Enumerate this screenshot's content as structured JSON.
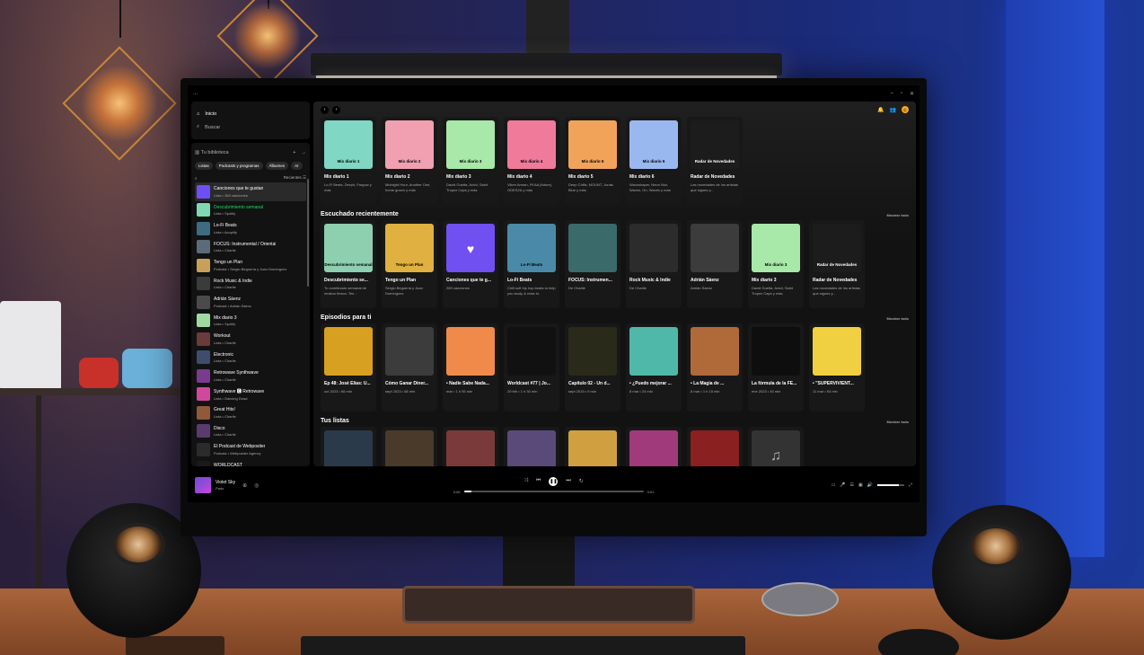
{
  "titlebar": {
    "menu": "...",
    "window_controls": [
      "–",
      "▫",
      "✕"
    ]
  },
  "sidebar": {
    "nav": [
      {
        "label": "Inicio",
        "icon": "home-icon",
        "symbol": "⌂",
        "active": true
      },
      {
        "label": "Buscar",
        "icon": "search-icon",
        "symbol": "⌕",
        "active": false
      }
    ],
    "library_title": "Tu biblioteca",
    "library_icon": "library-icon",
    "add_symbol": "+",
    "expand_symbol": "→",
    "chips": [
      "Listas",
      "Podcasts y programas",
      "Álbumes",
      "Ar"
    ],
    "sort_label": "Recientes",
    "items": [
      {
        "title": "Canciones que te gustan",
        "sub": "Lista • 269 canciones",
        "color": "#6e4ff5",
        "selected": true,
        "green": false
      },
      {
        "title": "Descubrimiento semanal",
        "sub": "Lista • Spotify",
        "color": "#7fd7b3",
        "selected": false,
        "green": true
      },
      {
        "title": "Lo-Fi Beats",
        "sub": "Lista • Acoplify",
        "color": "#3d6b82",
        "selected": false,
        "green": false
      },
      {
        "title": "FOCUS: Instrumental / Oriental",
        "sub": "Lista • Charlie",
        "color": "#5b6b7a",
        "selected": false,
        "green": false
      },
      {
        "title": "Tengo un Plan",
        "sub": "Podcast • Sergio Beguería y Juan Domínguez",
        "color": "#c7a15a",
        "selected": false,
        "green": false
      },
      {
        "title": "Rock Music & Indie",
        "sub": "Lista • Charlie",
        "color": "#3b3b3b",
        "selected": false,
        "green": false
      },
      {
        "title": "Adrián Sáenz",
        "sub": "Podcast • Adrián Sáenz",
        "color": "#4a4a4a",
        "selected": false,
        "green": false
      },
      {
        "title": "Mix diario 3",
        "sub": "Lista • Spotify",
        "color": "#9fd9a0",
        "selected": false,
        "green": false
      },
      {
        "title": "Workout",
        "sub": "Lista • Charlie",
        "color": "#6a3b3b",
        "selected": false,
        "green": false
      },
      {
        "title": "Electronic",
        "sub": "Lista • Charlie",
        "color": "#3e4d6e",
        "selected": false,
        "green": false
      },
      {
        "title": "Retrowave Synthwave",
        "sub": "Lista • Charlie",
        "color": "#7a3b8e",
        "selected": false,
        "green": false
      },
      {
        "title": "Synthwave 🅴 Retrowave",
        "sub": "Lista • Dancing Dead",
        "color": "#d0489e",
        "selected": false,
        "green": false
      },
      {
        "title": "Great Hits!",
        "sub": "Lista • Charlie",
        "color": "#8e5a3b",
        "selected": false,
        "green": false
      },
      {
        "title": "Disco",
        "sub": "Lista • Charlie",
        "color": "#5a3b6e",
        "selected": false,
        "green": false
      },
      {
        "title": "El Podcast de Webpositer",
        "sub": "Podcast • Webpositer Agency",
        "color": "#2b2b2b",
        "selected": false,
        "green": false
      },
      {
        "title": "WORLDCAST",
        "sub": "Podcast • WORLDCAST",
        "color": "#1a1a1a",
        "selected": false,
        "green": false
      }
    ]
  },
  "main": {
    "nav_back": "‹",
    "nav_forward": "›",
    "avatar_letter": "C",
    "mixes": [
      {
        "title": "Mix diario 1",
        "art_label": "Mix diario 1",
        "sub": "Lo-Fi Beats, Zeeph, Fargow y más",
        "color": "#7fd7c4"
      },
      {
        "title": "Mix diario 2",
        "art_label": "Mix diario 2",
        "sub": "Midnight Hour, Another One, home grown y más",
        "color": "#f0a0b0"
      },
      {
        "title": "Mix diario 3",
        "art_label": "Mix diario 3",
        "sub": "David Guetta, Avicii, Saint Tropez Caps y más",
        "color": "#a8e8a8"
      },
      {
        "title": "Mix diario 4",
        "art_label": "Mix diario 4",
        "sub": "Viken Arman, FKAA (future), ODESZA y más",
        "color": "#f07a9a"
      },
      {
        "title": "Mix diario 5",
        "art_label": "Mix diario 5",
        "sub": "Deep Chills, MOUNT, Jonas Blue y más",
        "color": "#f2a35a"
      },
      {
        "title": "Mix diario 6",
        "art_label": "Mix diario 6",
        "sub": "Wavoshaper, Neon Nox, Waves, On, Waves y más",
        "color": "#9ab8f0"
      },
      {
        "title": "Radar de Novedades",
        "art_label": "Radar de Novedades",
        "sub": "Las novedades de los artistas que sigues y...",
        "color": "#1c1c1c"
      }
    ],
    "recent_title": "Escuchado recientemente",
    "show_all": "Mostrar todo",
    "recent": [
      {
        "title": "Descubrimiento se...",
        "art_label": "Descubrimiento semanal",
        "sub": "Tu combinado semanal de música fresca. Ten...",
        "color": "#8ecfb0",
        "round": false
      },
      {
        "title": "Tengo un Plan",
        "art_label": "Tengo un Plan",
        "sub": "Sergio Beguería y Juan Domínguez",
        "color": "#e0b040",
        "round": false
      },
      {
        "title": "Canciones que te g...",
        "art_label": "♥",
        "sub": "269 canciones",
        "color": "#7050f0",
        "round": false
      },
      {
        "title": "Lo-Fi Beats",
        "art_label": "Lo-Fi Beats",
        "sub": "Chill soft hip hop beats to help you study & relax to.",
        "color": "#4a8aa8",
        "round": false
      },
      {
        "title": "FOCUS: Instrumen...",
        "art_label": "",
        "sub": "De Charlie",
        "color": "#3a6a6a",
        "round": false
      },
      {
        "title": "Rock Music & Indie",
        "art_label": "",
        "sub": "De Charlie",
        "color": "#2c2c2c",
        "round": false
      },
      {
        "title": "Adrián Sáenz",
        "art_label": "",
        "sub": "Adrián Sáenz",
        "color": "#3c3c3c",
        "round": false
      },
      {
        "title": "Mix diario 3",
        "art_label": "Mix diario 3",
        "sub": "David Guetta, Avicii, Saint Tropez Caps y más",
        "color": "#a8e8a8",
        "round": false
      },
      {
        "title": "Radar de Novedades",
        "art_label": "Radar de Novedades",
        "sub": "Las novedades de los artistas que sigues y...",
        "color": "#1c1c1c",
        "round": false
      }
    ],
    "episodes_title": "Episodios para ti",
    "episodes": [
      {
        "title": "Ep 48: José Elías: U...",
        "sub": "oct 2023 • 66 min",
        "color": "#d8a020"
      },
      {
        "title": "Cómo Ganar Diner...",
        "sub": "sept 2023 • 68 min",
        "color": "#3c3c3c"
      },
      {
        "title": "• Nadie Sabe Nada...",
        "sub": "mar • 1 h 55 min",
        "color": "#f08a4a"
      },
      {
        "title": "Worldcast #77 | Jo...",
        "sub": "29 feb • 1 h 30 min",
        "color": "#111111"
      },
      {
        "title": "Capítulo 02 - Un d...",
        "sub": "sept 2019 • 9 min",
        "color": "#2a2a1a"
      },
      {
        "title": "• ¿Puedo mejorar ...",
        "sub": "8 mar • 24 min",
        "color": "#50b8a8"
      },
      {
        "title": "• La Magia de ...",
        "sub": "8 mar • 1 h 15 min",
        "color": "#b06a3a"
      },
      {
        "title": "La fórmula de la FE...",
        "sub": "ene 2023 • 45 min",
        "color": "#0e0e0e"
      },
      {
        "title": "• \"SUPERVIVIENT...",
        "sub": "11 mar • 54 min",
        "color": "#f0d040"
      }
    ],
    "lists_title": "Tus listas",
    "lists": [
      {
        "color": "#2a3a4a"
      },
      {
        "color": "#4a3a2a"
      },
      {
        "color": "#7a3a3a"
      },
      {
        "color": "#5a4a7a"
      },
      {
        "color": "#d0a040"
      },
      {
        "color": "#a03a7a"
      },
      {
        "color": "#8a2020"
      },
      {
        "color": "#333333"
      }
    ],
    "lists_placeholder_symbol": "♫"
  },
  "player": {
    "title": "Violet Sky",
    "artist": "Pado",
    "elapsed": "0:06",
    "duration": "3:01",
    "progress": 0.04,
    "volume": 0.8,
    "controls": {
      "shuffle": "⤨",
      "prev": "⏮",
      "play": "❚❚",
      "next": "⏭",
      "repeat": "↻"
    },
    "extras": [
      "▭",
      "🎤",
      "☰",
      "▣",
      "🔊"
    ]
  }
}
